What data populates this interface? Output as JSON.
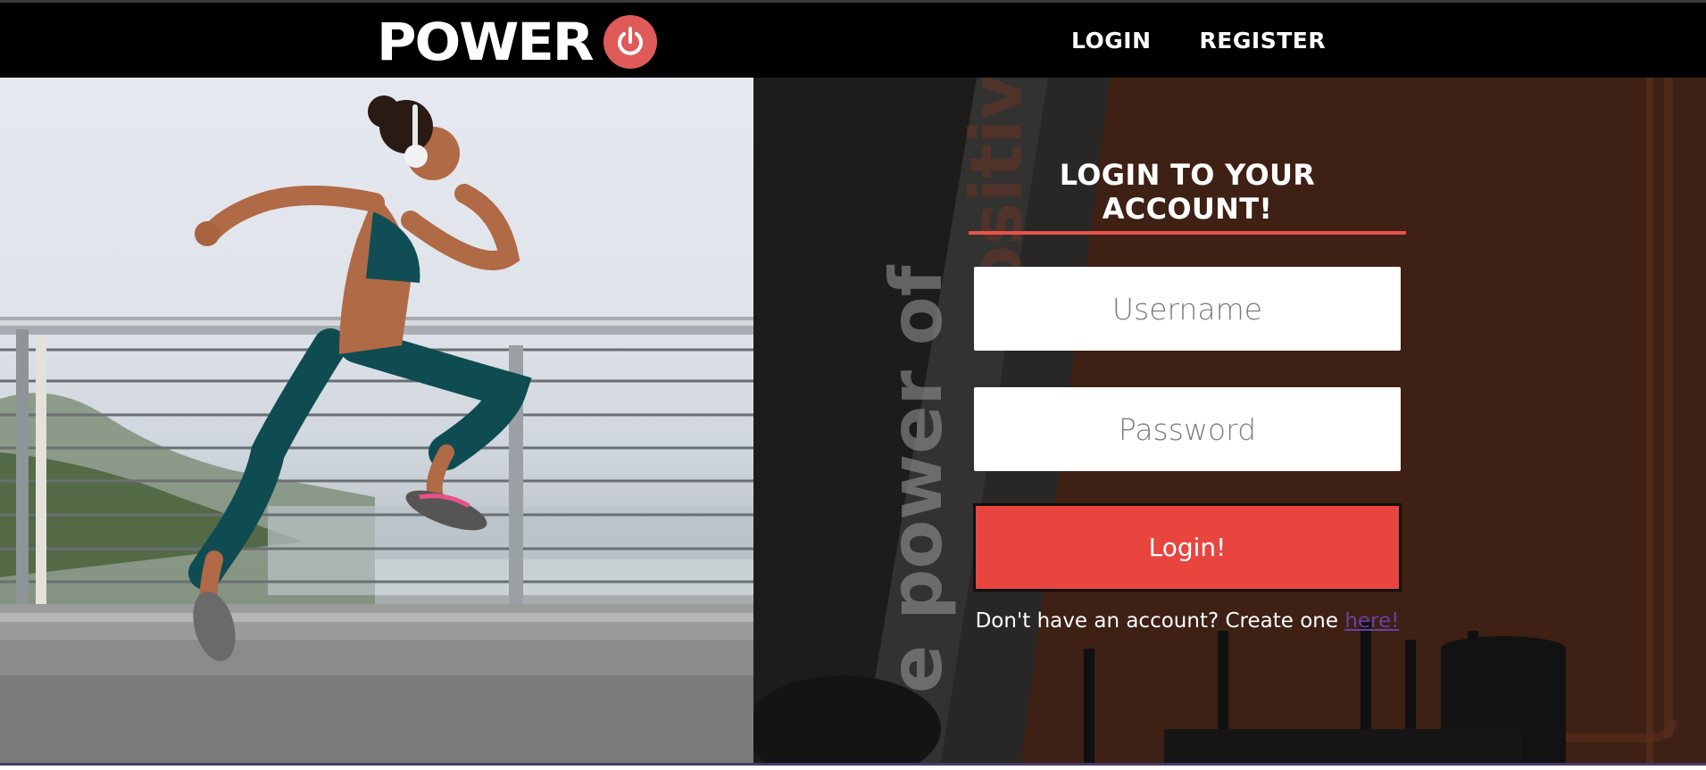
{
  "brand": {
    "wordmark": "POWER",
    "logo_icon": "power-symbol-icon",
    "accent_color": "#e05a5a"
  },
  "nav": {
    "login_label": "LOGIN",
    "register_label": "REGISTER"
  },
  "hero_image": {
    "subject": "woman-running-photo"
  },
  "background_image": {
    "subject": "gym-wall-photo"
  },
  "login_form": {
    "title": "LOGIN TO YOUR ACCOUNT!",
    "username_placeholder": "Username",
    "password_placeholder": "Password",
    "submit_label": "Login!",
    "signup_prompt": "Don't have an account? Create one ",
    "signup_link_label": "here!",
    "button_color": "#e8453f",
    "underline_color": "#e8524a"
  }
}
